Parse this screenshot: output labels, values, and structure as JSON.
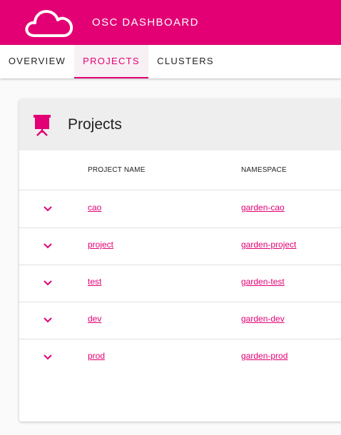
{
  "app": {
    "title": "OSC DASHBOARD",
    "logo_icon": "cloud-icon",
    "brand_color": "#e20074"
  },
  "tabs": [
    {
      "label": "OVERVIEW",
      "active": false
    },
    {
      "label": "PROJECTS",
      "active": true
    },
    {
      "label": "CLUSTERS",
      "active": false
    }
  ],
  "card": {
    "title": "Projects",
    "icon": "presentation-board-icon",
    "columns": [
      "PROJECT NAME",
      "NAMESPACE"
    ],
    "rows": [
      {
        "project": "cao",
        "namespace": "garden-cao"
      },
      {
        "project": "project",
        "namespace": "garden-project"
      },
      {
        "project": "test",
        "namespace": "garden-test"
      },
      {
        "project": "dev",
        "namespace": "garden-dev"
      },
      {
        "project": "prod",
        "namespace": "garden-prod"
      }
    ]
  }
}
